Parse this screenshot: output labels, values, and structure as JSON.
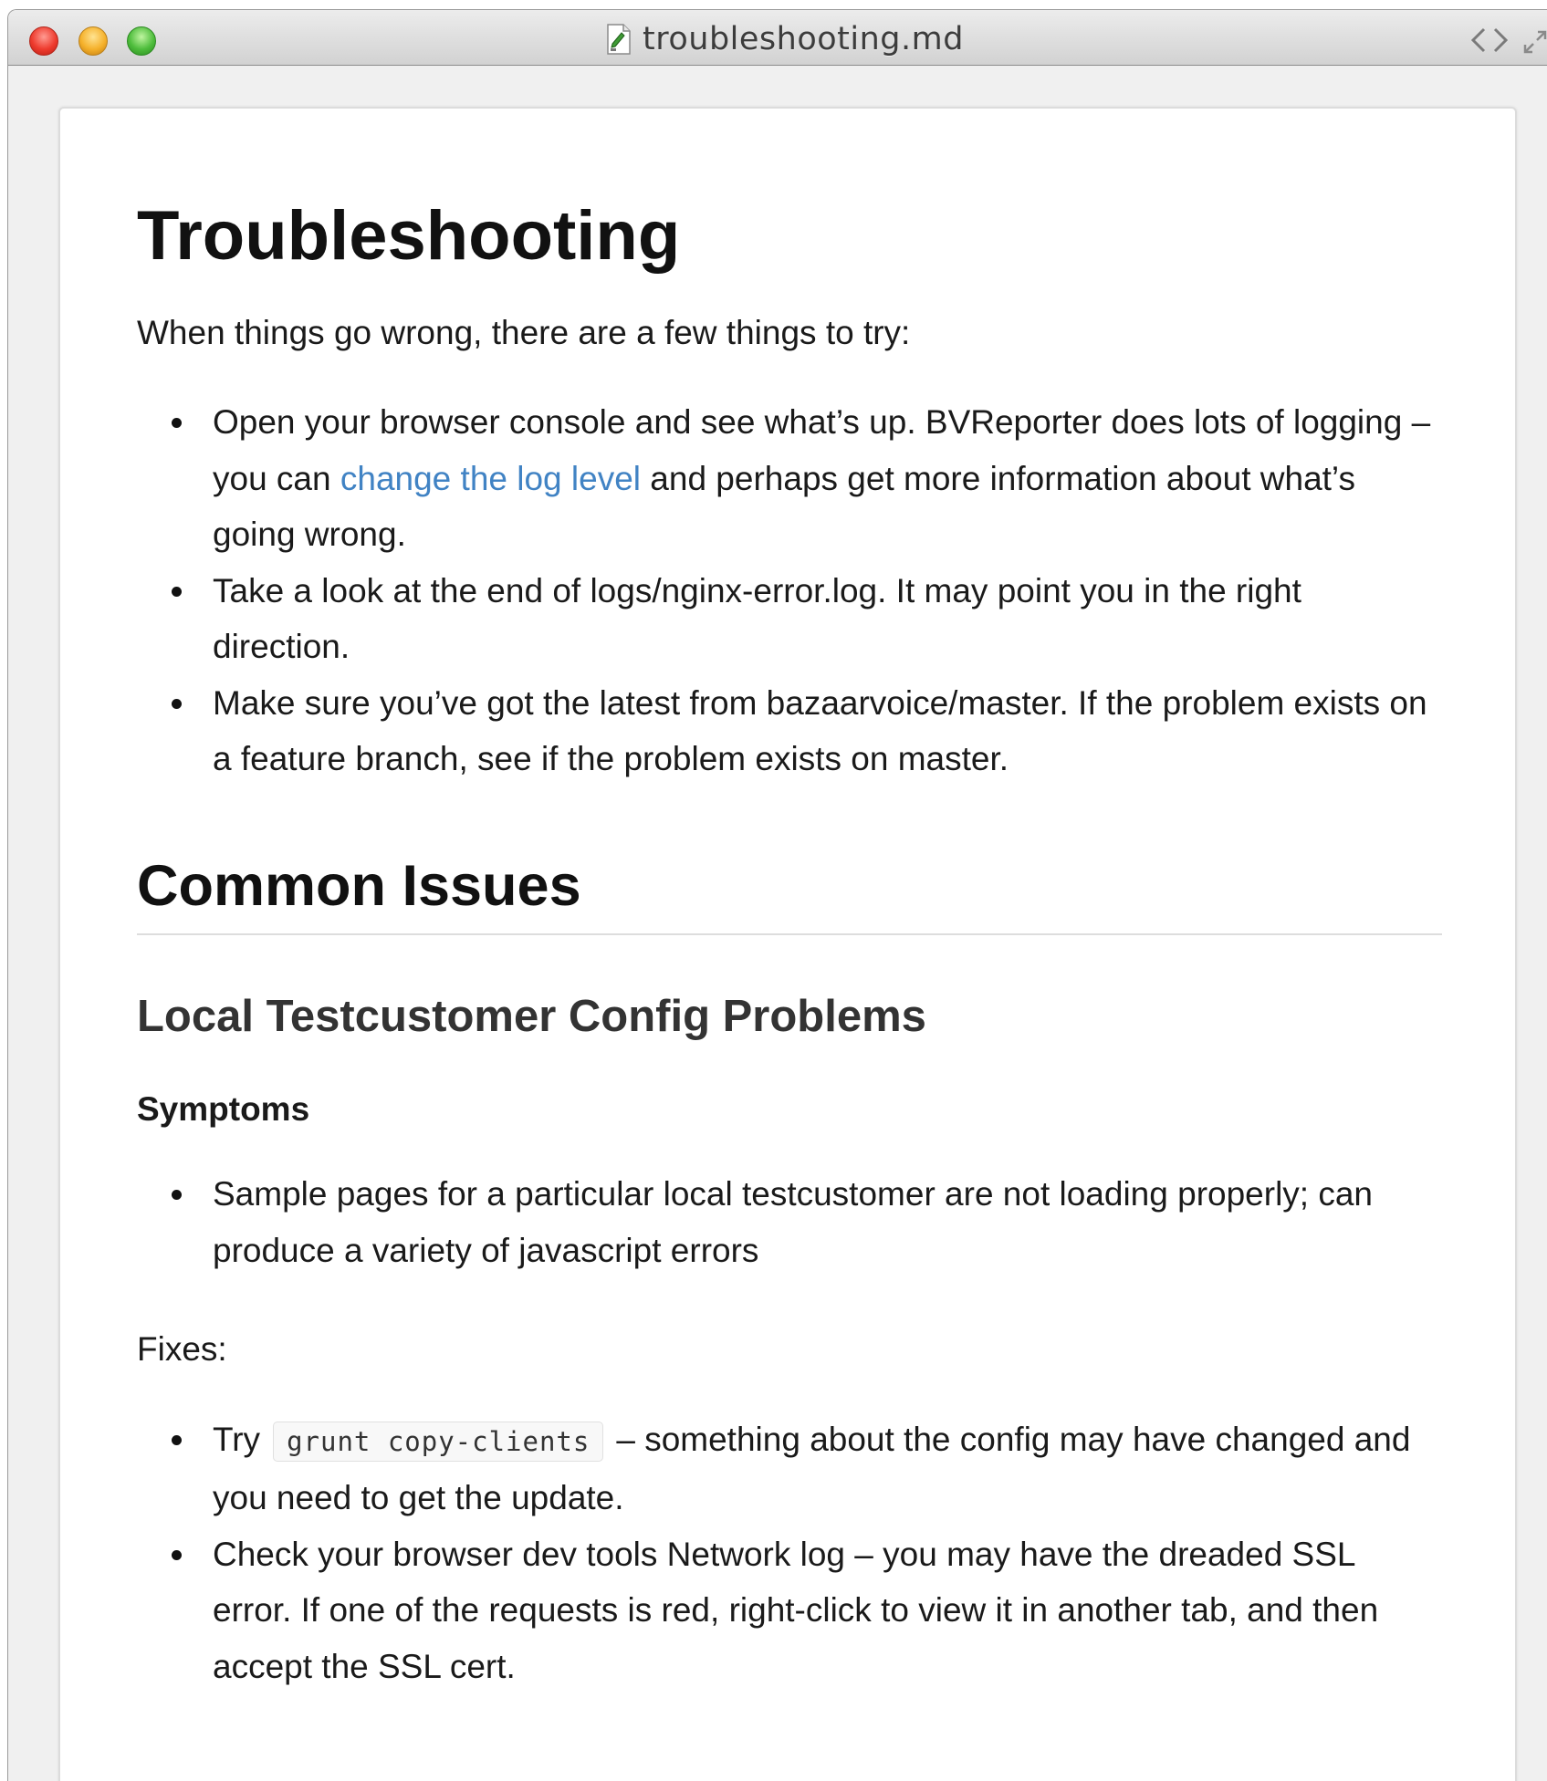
{
  "window": {
    "title": "troubleshooting.md"
  },
  "doc": {
    "h1": "Troubleshooting",
    "intro": "When things go wrong, there are a few things to try:",
    "tips": {
      "item1_before": "Open your browser console and see what’s up. BVReporter does lots of logging – you can ",
      "item1_link": "change the log level",
      "item1_after": " and perhaps get more information about what’s going wrong.",
      "item2": "Take a look at the end of logs/nginx-error.log. It may point you in the right direction.",
      "item3": "Make sure you’ve got the latest from bazaarvoice/master. If the problem exists on a feature branch, see if the problem exists on master."
    },
    "h2": "Common Issues",
    "h3": "Local Testcustomer Config Problems",
    "symptoms_heading": "Symptoms",
    "symptom1": "Sample pages for a particular local testcustomer are not loading properly; can produce a variety of javascript errors",
    "fixes_label": "Fixes:",
    "fix1_before": "Try",
    "fix1_code": "grunt copy-clients",
    "fix1_after": "– something about the config may have changed and you need to get the update.",
    "fix2": "Check your browser dev tools Network log – you may have the dreaded SSL error. If one of the requests is red, right-click to view it in another tab, and then accept the SSL cert."
  },
  "colors": {
    "link": "#4183c4",
    "close_button": "#ee3b2e",
    "minimize_button": "#f5b12b",
    "zoom_button": "#4ebd3c"
  }
}
